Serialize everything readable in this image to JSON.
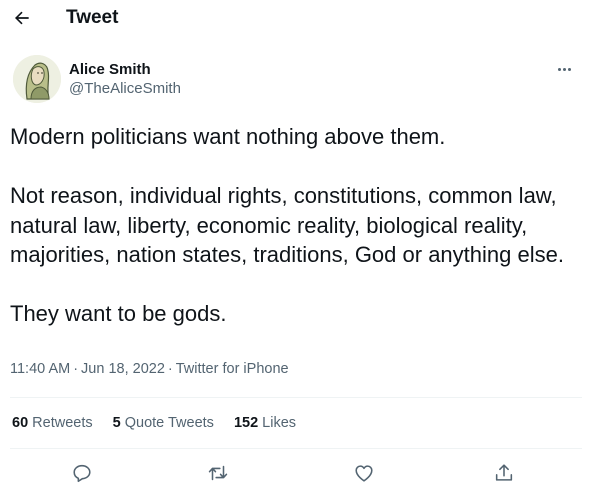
{
  "header": {
    "back_icon": "arrow-left-icon",
    "title": "Tweet"
  },
  "author": {
    "name": "Alice Smith",
    "handle": "@TheAliceSmith",
    "avatar_icon": "avatar-illustration"
  },
  "tweet": {
    "paragraphs": [
      "Modern politicians want nothing above them.",
      "Not reason, individual rights, constitutions, common law, natural law, liberty, economic reality, biological reality, majorities, nation states, traditions, God or anything else.",
      "They want to be gods."
    ],
    "time": "11:40 AM",
    "date": "Jun 18, 2022",
    "source": "Twitter for iPhone",
    "separator": "·"
  },
  "stats": {
    "retweets_count": "60",
    "retweets_label": "Retweets",
    "quotes_count": "5",
    "quotes_label": "Quote Tweets",
    "likes_count": "152",
    "likes_label": "Likes"
  },
  "actions": [
    "reply-icon",
    "retweet-icon",
    "like-icon",
    "share-icon"
  ],
  "colors": {
    "text": "#0f1419",
    "secondary": "#536471",
    "divider": "#eff3f4"
  }
}
